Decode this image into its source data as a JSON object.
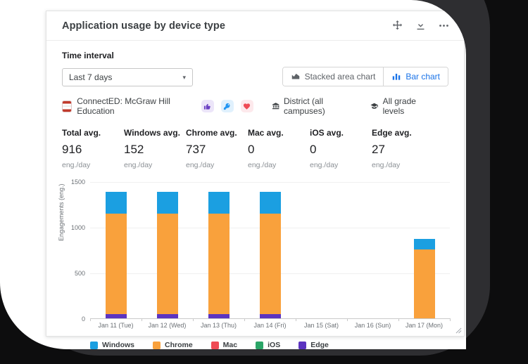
{
  "card": {
    "title": "Application usage by device type",
    "header_icons": [
      "move-icon",
      "download-icon",
      "more-icon"
    ],
    "time_interval": {
      "label": "Time interval",
      "selected": "Last 7 days"
    },
    "chart_toggle": {
      "stacked_label": "Stacked area chart",
      "bar_label": "Bar chart",
      "active": "Bar chart"
    },
    "context": {
      "app_name": "ConnectED: McGraw Hill Education",
      "badges": [
        "thumbs-up-icon",
        "key-icon",
        "heart-icon"
      ],
      "scope": "District (all campuses)",
      "scope_icon": "bank-icon",
      "grades": "All grade levels",
      "grades_icon": "graduation-cap-icon"
    },
    "stats": [
      {
        "label": "Total avg.",
        "value": "916",
        "unit": "eng./day"
      },
      {
        "label": "Windows avg.",
        "value": "152",
        "unit": "eng./day"
      },
      {
        "label": "Chrome avg.",
        "value": "737",
        "unit": "eng./day"
      },
      {
        "label": "Mac avg.",
        "value": "0",
        "unit": "eng./day"
      },
      {
        "label": "iOS avg.",
        "value": "0",
        "unit": "eng./day"
      },
      {
        "label": "Edge avg.",
        "value": "27",
        "unit": "eng./day"
      }
    ],
    "colors": {
      "accent_blue": "#1a73e8",
      "badge_thumb": "#6a3fc3",
      "badge_key": "#2196f3",
      "badge_heart": "#ef4b55"
    }
  },
  "chart_data": {
    "type": "bar",
    "stacked": true,
    "title": "",
    "xlabel": "",
    "ylabel": "Engagements (eng.)",
    "ylim": [
      0,
      1500
    ],
    "yticks": [
      0,
      500,
      1000,
      1500
    ],
    "grid": true,
    "legend_position": "bottom",
    "categories": [
      "Jan 11 (Tue)",
      "Jan 12 (Wed)",
      "Jan 13 (Thu)",
      "Jan 14 (Fri)",
      "Jan 15 (Sat)",
      "Jan 16 (Sun)",
      "Jan 17 (Mon)"
    ],
    "series": [
      {
        "name": "Windows",
        "color": "#1b9fe1",
        "values": [
          237,
          237,
          237,
          237,
          0,
          0,
          116
        ]
      },
      {
        "name": "Chrome",
        "color": "#f9a13c",
        "values": [
          1101,
          1101,
          1101,
          1101,
          0,
          0,
          755
        ]
      },
      {
        "name": "Mac",
        "color": "#ef4b55",
        "values": [
          0,
          0,
          0,
          0,
          0,
          0,
          0
        ]
      },
      {
        "name": "iOS",
        "color": "#2ba567",
        "values": [
          0,
          0,
          0,
          0,
          0,
          0,
          0
        ]
      },
      {
        "name": "Edge",
        "color": "#5c34c0",
        "values": [
          47,
          47,
          47,
          47,
          0,
          0,
          0
        ]
      }
    ],
    "stack_order_bottom_to_top": [
      "Edge",
      "iOS",
      "Mac",
      "Chrome",
      "Windows"
    ],
    "daily_totals": [
      1385,
      1385,
      1385,
      1385,
      0,
      0,
      871
    ]
  }
}
